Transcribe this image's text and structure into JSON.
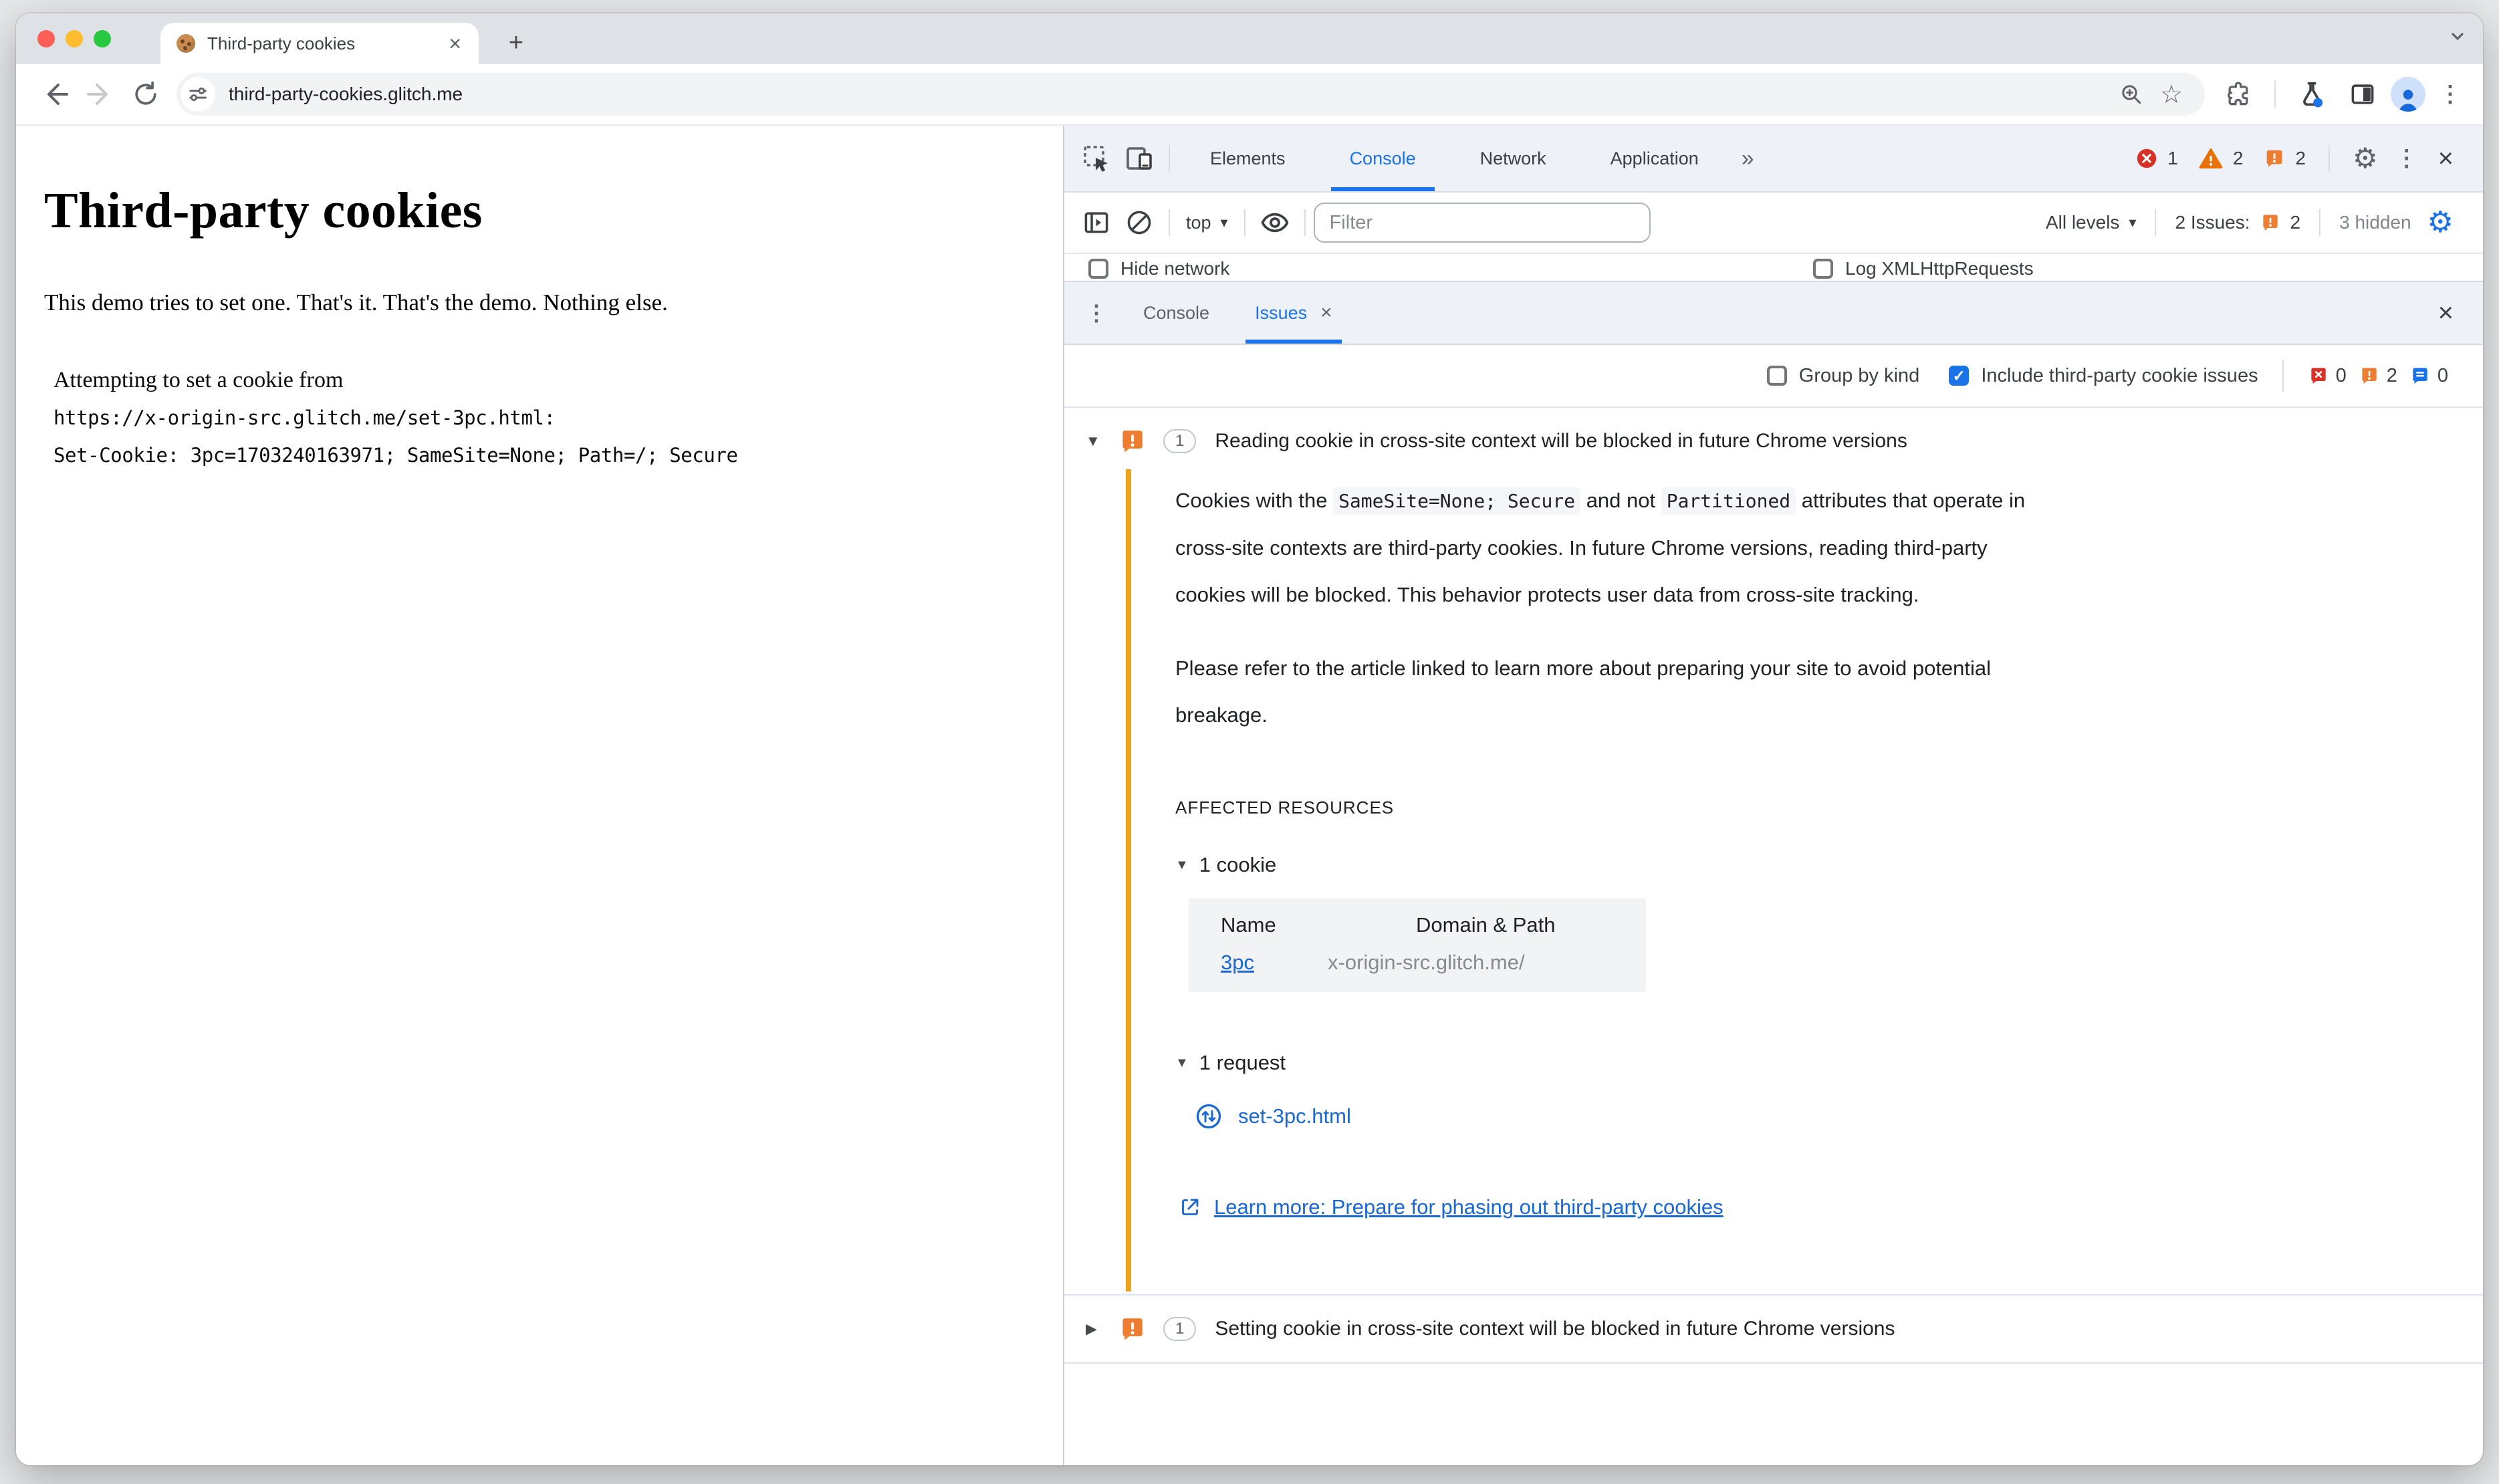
{
  "glyphs": {
    "caret": "▾",
    "tri_down": "▼",
    "tri_right": "▶",
    "close": "×",
    "gear": "⚙",
    "star": "☆",
    "kebab": "⋮",
    "more": "»",
    "plus": "+",
    "check": "✓"
  },
  "browser": {
    "tab_title": "Third-party cookies",
    "url": "third-party-cookies.glitch.me"
  },
  "page": {
    "heading": "Third-party cookies",
    "intro": "This demo tries to set one. That's it. That's the demo. Nothing else.",
    "attempt_line": "Attempting to set a cookie from",
    "attempt_url": "https://x-origin-src.glitch.me/set-3pc.html:",
    "set_cookie": "Set-Cookie: 3pc=1703240163971; SameSite=None; Path=/; Secure"
  },
  "devtools": {
    "tabs": [
      "Elements",
      "Console",
      "Network",
      "Application"
    ],
    "top_badges": {
      "errors": "1",
      "warnings": "2",
      "issues": "2"
    },
    "console_toolbar": {
      "context": "top",
      "filter_placeholder": "Filter",
      "levels": "All levels",
      "issues_label": "2 Issues:",
      "issues_count": "2",
      "hidden": "3 hidden"
    },
    "settings_row": {
      "hide_network": "Hide network",
      "log_xhr": "Log XMLHttpRequests"
    },
    "drawer": {
      "console_tab": "Console",
      "issues_tab": "Issues"
    },
    "issues_toolbar": {
      "group_by_kind": "Group by kind",
      "include_third_party": "Include third-party cookie issues",
      "error_count": "0",
      "warning_count": "2",
      "info_count": "0"
    },
    "issue1": {
      "count": "1",
      "title": "Reading cookie in cross-site context will be blocked in future Chrome versions",
      "p1_a": "Cookies with the ",
      "p1_code1": "SameSite=None; Secure",
      "p1_b": " and not ",
      "p1_code2": "Partitioned",
      "p1_c": " attributes that operate in cross-site contexts are third-party cookies. In future Chrome versions, reading third-party cookies will be blocked. This behavior protects user data from cross-site tracking.",
      "p2": "Please refer to the article linked to learn more about preparing your site to avoid potential breakage.",
      "affected_heading": "AFFECTED RESOURCES",
      "cookie_group": "1 cookie",
      "col_name": "Name",
      "col_domain": "Domain & Path",
      "cookie_name": "3pc",
      "cookie_domain": "x-origin-src.glitch.me/",
      "request_group": "1 request",
      "request_file": "set-3pc.html",
      "learn_more": "Learn more: Prepare for phasing out third-party cookies"
    },
    "issue2": {
      "count": "1",
      "title": "Setting cookie in cross-site context will be blocked in future Chrome versions"
    }
  }
}
